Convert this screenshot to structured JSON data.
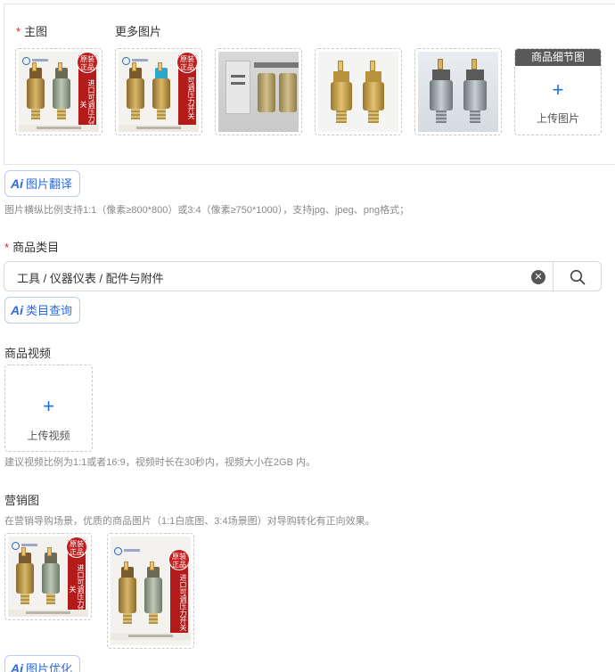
{
  "images": {
    "main_label": "主图",
    "more_label": "更多图片",
    "required_mark": "*",
    "badge_text": "原装正品",
    "ribbon_text_1": "进口可调压力开关",
    "ribbon_text_2": "可调压力开关",
    "detail_header": "商品细节图",
    "upload_label": "上传图片",
    "translate_button": "图片翻译",
    "ai_mark": "Ai",
    "hint": "图片横纵比例支持1:1（像素≥800*800）或3:4（像素≥750*1000），支持jpg、jpeg、png格式；"
  },
  "category": {
    "required_mark": "*",
    "label": "商品类目",
    "value": "工具 / 仪器仪表 / 配件与附件",
    "query_button": "类目查询",
    "ai_mark": "Ai"
  },
  "video": {
    "label": "商品视频",
    "upload_label": "上传视频",
    "hint": "建议视频比例为1:1或者16:9，视频时长在30秒内，视频大小在2GB 内。"
  },
  "marketing": {
    "label": "营销图",
    "hint": "在营销导购场景，优质的商品图片（1:1白底图、3:4场景图）对导购转化有正向效果。",
    "optimize_button": "图片优化",
    "ai_mark": "Ai"
  },
  "icons": {
    "plus": "+",
    "clear": "✕"
  },
  "colors": {
    "accent": "#2e6ae6",
    "required": "#e02020",
    "ribbon": "#b31b1b"
  }
}
